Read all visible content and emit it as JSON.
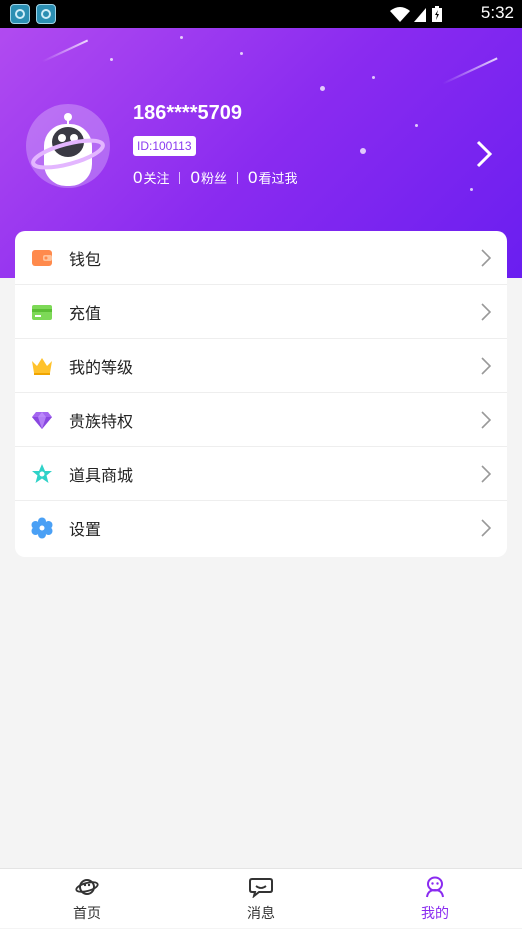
{
  "status_bar": {
    "time": "5:32"
  },
  "profile": {
    "phone": "186****5709",
    "id": "ID:100113",
    "stats": [
      {
        "count": "0",
        "label": "关注"
      },
      {
        "count": "0",
        "label": "粉丝"
      },
      {
        "count": "0",
        "label": "看过我"
      }
    ]
  },
  "menu": {
    "items": [
      {
        "label": "钱包",
        "icon": "wallet-icon",
        "color": "#ff8a4c"
      },
      {
        "label": "充值",
        "icon": "card-icon",
        "color": "#7dd957"
      },
      {
        "label": "我的等级",
        "icon": "crown-icon",
        "color": "#ffc22c"
      },
      {
        "label": "贵族特权",
        "icon": "diamond-icon",
        "color": "#a466f0"
      },
      {
        "label": "道具商城",
        "icon": "star-icon",
        "color": "#2fd2c8"
      },
      {
        "label": "设置",
        "icon": "flower-gear-icon",
        "color": "#4aa0f5"
      }
    ]
  },
  "tabbar": {
    "tabs": [
      {
        "label": "首页",
        "icon": "planet-icon",
        "active": false
      },
      {
        "label": "消息",
        "icon": "chat-bubble-icon",
        "active": false
      },
      {
        "label": "我的",
        "icon": "user-icon",
        "active": true
      }
    ]
  },
  "colors": {
    "accent": "#8a2bf0",
    "header_start": "#b14bf0",
    "header_end": "#6a1ef0"
  }
}
